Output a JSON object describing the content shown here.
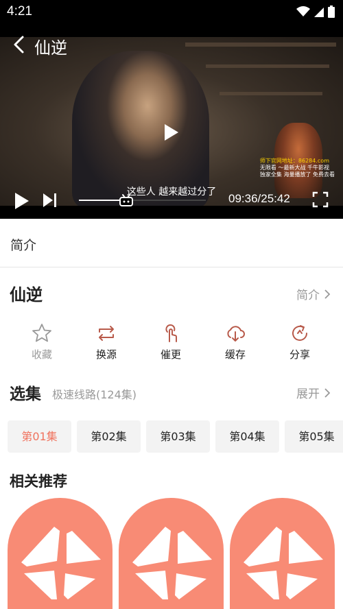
{
  "status_bar": {
    "time": "4:21"
  },
  "player": {
    "title": "仙逆",
    "subtitle": "这些人 越来越过分了",
    "overlay_lines": [
      "师下官网地址：86284.com",
      "无限看 ～最新大战 千牛影视",
      "独家全集 海量播放了 免费去看"
    ],
    "time": "09:36/25:42",
    "progress": 0.374
  },
  "tabs": {
    "intro": "简介"
  },
  "show": {
    "title": "仙逆",
    "intro_link": "简介"
  },
  "actions": [
    {
      "label": "收藏",
      "icon": "star-icon"
    },
    {
      "label": "换源",
      "icon": "switch-source-icon"
    },
    {
      "label": "催更",
      "icon": "finger-tap-icon"
    },
    {
      "label": "缓存",
      "icon": "cloud-download-icon"
    },
    {
      "label": "分享",
      "icon": "share-icon"
    }
  ],
  "episodes": {
    "title": "选集",
    "route": "极速线路(124集)",
    "expand": "展开",
    "items": [
      "第01集",
      "第02集",
      "第03集",
      "第04集",
      "第05集"
    ]
  },
  "related": {
    "title": "相关推荐"
  },
  "colors": {
    "accent": "#f0725d",
    "tile": "#f88b75"
  }
}
